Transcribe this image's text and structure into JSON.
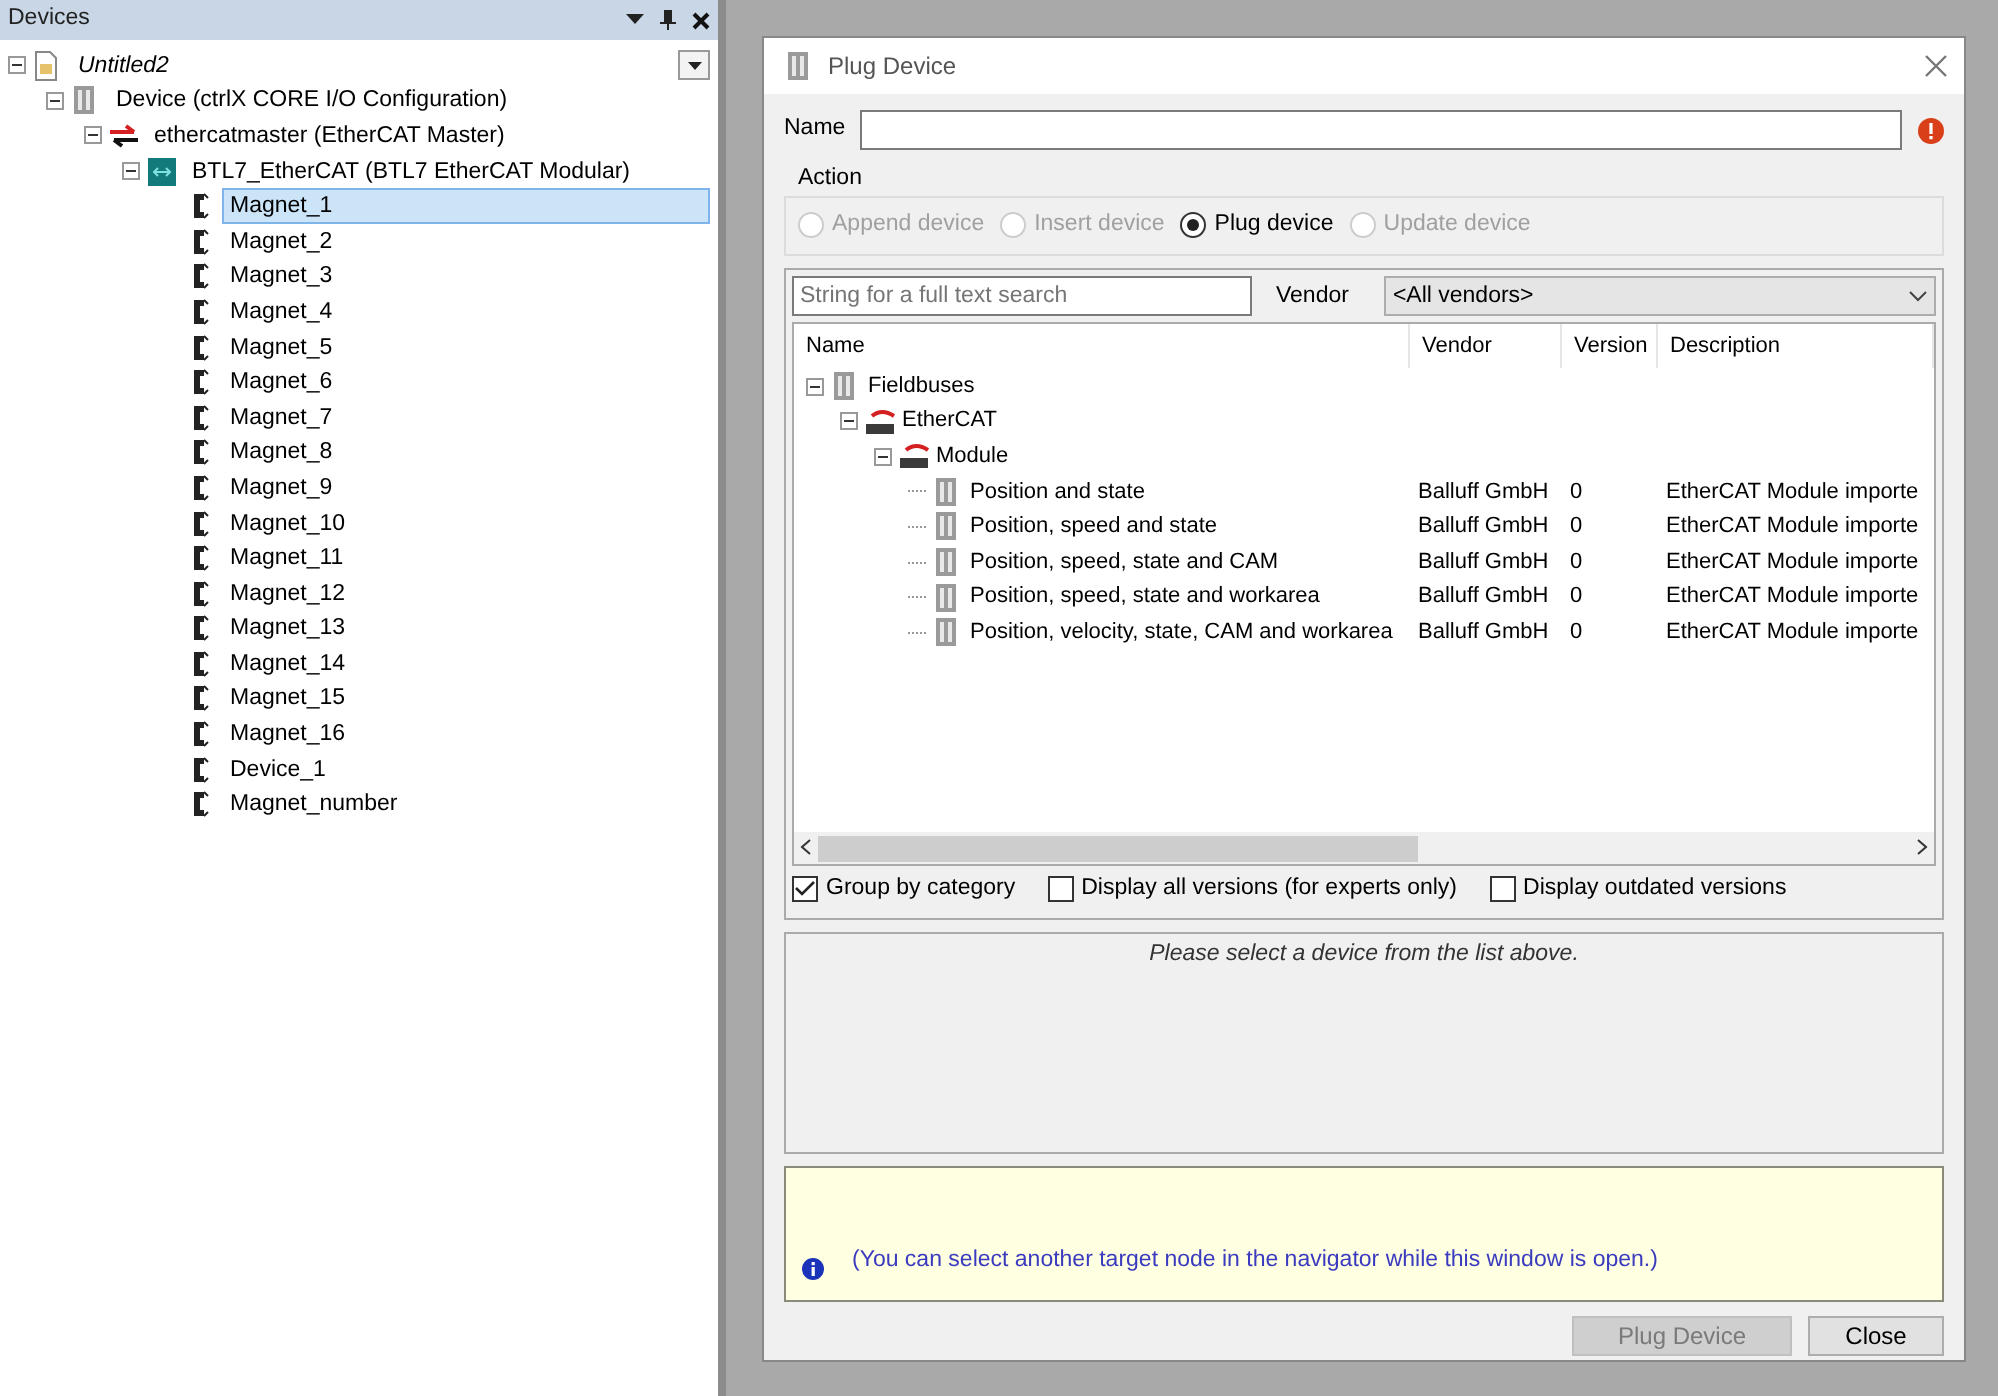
{
  "devices_panel": {
    "title": "Devices",
    "tree": [
      {
        "label": "Untitled2",
        "kind": "project",
        "expanded": true,
        "selected": false,
        "children": [
          {
            "label": "Device (ctrlX CORE I/O Configuration)",
            "kind": "device",
            "expanded": true,
            "selected": false,
            "children": [
              {
                "label": "ethercatmaster (EtherCAT Master)",
                "kind": "master",
                "expanded": true,
                "selected": false,
                "children": [
                  {
                    "label": "BTL7_EtherCAT (BTL7 EtherCAT Modular)",
                    "kind": "slave",
                    "expanded": true,
                    "selected": false,
                    "children": [
                      {
                        "label": "Magnet_1",
                        "kind": "module",
                        "selected": true
                      },
                      {
                        "label": "Magnet_2",
                        "kind": "module",
                        "selected": false
                      },
                      {
                        "label": "Magnet_3",
                        "kind": "module",
                        "selected": false
                      },
                      {
                        "label": "Magnet_4",
                        "kind": "module",
                        "selected": false
                      },
                      {
                        "label": "Magnet_5",
                        "kind": "module",
                        "selected": false
                      },
                      {
                        "label": "Magnet_6",
                        "kind": "module",
                        "selected": false
                      },
                      {
                        "label": "Magnet_7",
                        "kind": "module",
                        "selected": false
                      },
                      {
                        "label": "Magnet_8",
                        "kind": "module",
                        "selected": false
                      },
                      {
                        "label": "Magnet_9",
                        "kind": "module",
                        "selected": false
                      },
                      {
                        "label": "Magnet_10",
                        "kind": "module",
                        "selected": false
                      },
                      {
                        "label": "Magnet_11",
                        "kind": "module",
                        "selected": false
                      },
                      {
                        "label": "Magnet_12",
                        "kind": "module",
                        "selected": false
                      },
                      {
                        "label": "Magnet_13",
                        "kind": "module",
                        "selected": false
                      },
                      {
                        "label": "Magnet_14",
                        "kind": "module",
                        "selected": false
                      },
                      {
                        "label": "Magnet_15",
                        "kind": "module",
                        "selected": false
                      },
                      {
                        "label": "Magnet_16",
                        "kind": "module",
                        "selected": false
                      },
                      {
                        "label": "Device_1",
                        "kind": "module",
                        "selected": false
                      },
                      {
                        "label": "Magnet_number",
                        "kind": "module",
                        "selected": false
                      }
                    ]
                  }
                ]
              }
            ]
          }
        ]
      }
    ]
  },
  "dialog": {
    "title": "Plug Device",
    "name_label": "Name",
    "action": {
      "label": "Action",
      "options": [
        {
          "label": "Append device",
          "selected": false,
          "disabled": true
        },
        {
          "label": "Insert device",
          "selected": false,
          "disabled": true
        },
        {
          "label": "Plug device",
          "selected": true,
          "disabled": false
        },
        {
          "label": "Update device",
          "selected": false,
          "disabled": true
        }
      ]
    },
    "search": {
      "placeholder": "String for a full text search"
    },
    "vendor": {
      "label": "Vendor",
      "value": "<All vendors>"
    },
    "columns": [
      "Name",
      "Vendor",
      "Version",
      "Description"
    ],
    "tree": [
      {
        "name": "Fieldbuses",
        "kind": "folder",
        "expanded": true,
        "children": [
          {
            "name": "EtherCAT",
            "kind": "bus",
            "expanded": true,
            "children": [
              {
                "name": "Module",
                "kind": "bus",
                "expanded": true,
                "children": [
                  {
                    "name": "Position and state",
                    "kind": "device",
                    "vendor": "Balluff GmbH",
                    "version": "0",
                    "description": "EtherCAT Module importe"
                  },
                  {
                    "name": "Position, speed and state",
                    "kind": "device",
                    "vendor": "Balluff GmbH",
                    "version": "0",
                    "description": "EtherCAT Module importe"
                  },
                  {
                    "name": "Position, speed, state and CAM",
                    "kind": "device",
                    "vendor": "Balluff GmbH",
                    "version": "0",
                    "description": "EtherCAT Module importe"
                  },
                  {
                    "name": "Position, speed, state and workarea",
                    "kind": "device",
                    "vendor": "Balluff GmbH",
                    "version": "0",
                    "description": "EtherCAT Module importe"
                  },
                  {
                    "name": "Position, velocity, state, CAM and workarea",
                    "kind": "device",
                    "vendor": "Balluff GmbH",
                    "version": "0",
                    "description": "EtherCAT Module importe"
                  }
                ]
              }
            ]
          }
        ]
      }
    ],
    "options": [
      {
        "label": "Group by category",
        "checked": true
      },
      {
        "label": "Display all versions (for experts only)",
        "checked": false
      },
      {
        "label": "Display outdated versions",
        "checked": false
      }
    ],
    "status": "Please select a device from the list above.",
    "info": "(You can select another target node in the navigator while this window is open.)",
    "buttons": [
      {
        "label": "Plug Device",
        "disabled": true
      },
      {
        "label": "Close",
        "disabled": false
      }
    ]
  }
}
